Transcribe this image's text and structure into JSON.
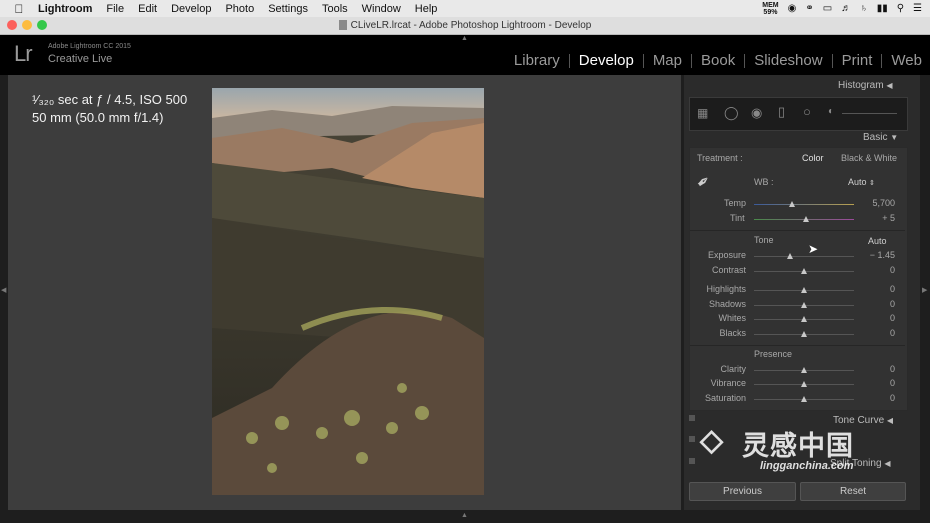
{
  "menubar": {
    "app_name": "Lightroom",
    "items": [
      "File",
      "Edit",
      "Develop",
      "Photo",
      "Settings",
      "Tools",
      "Window",
      "Help"
    ],
    "mem_label": "MEM",
    "mem_value": "59%"
  },
  "window": {
    "title": "CLiveLR.lrcat - Adobe Photoshop Lightroom - Develop"
  },
  "header": {
    "logo": "Lr",
    "product_line1": "Adobe Lightroom CC 2015",
    "product_line2": "Creative Live",
    "modules": [
      "Library",
      "Develop",
      "Map",
      "Book",
      "Slideshow",
      "Print",
      "Web"
    ],
    "active_module": "Develop"
  },
  "exif": {
    "line1": "¹⁄₃₂₀ sec at ƒ / 4.5, ISO 500",
    "line2": "50 mm (50.0 mm f/1.4)"
  },
  "panel": {
    "histogram_label": "Histogram",
    "basic_label": "Basic",
    "treatment_label": "Treatment :",
    "treatment_color": "Color",
    "treatment_bw": "Black & White",
    "wb_label": "WB :",
    "wb_value": "Auto",
    "temp_label": "Temp",
    "temp_value": "5,700",
    "tint_label": "Tint",
    "tint_value": "+ 5",
    "tone_label": "Tone",
    "tone_auto": "Auto",
    "tone_sliders": [
      {
        "label": "Exposure",
        "value": "− 1.45"
      },
      {
        "label": "Contrast",
        "value": "0"
      },
      {
        "label": "Highlights",
        "value": "0"
      },
      {
        "label": "Shadows",
        "value": "0"
      },
      {
        "label": "Whites",
        "value": "0"
      },
      {
        "label": "Blacks",
        "value": "0"
      }
    ],
    "presence_label": "Presence",
    "presence_sliders": [
      {
        "label": "Clarity",
        "value": "0"
      },
      {
        "label": "Vibrance",
        "value": "0"
      },
      {
        "label": "Saturation",
        "value": "0"
      }
    ],
    "tone_curve_label": "Tone Curve",
    "split_toning_label": "Split Toning",
    "previous_button": "Previous",
    "reset_button": "Reset"
  },
  "watermark": {
    "cn_text": "灵感中国",
    "url": "lingganchina.com"
  }
}
